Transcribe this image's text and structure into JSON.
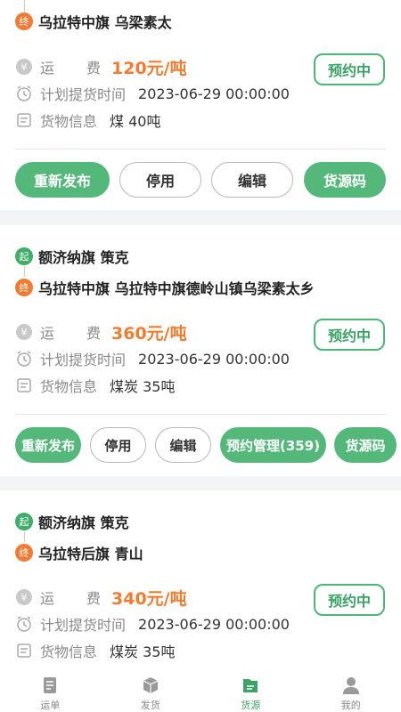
{
  "cards": [
    {
      "end_label": "乌拉特中旗 乌梁素太",
      "fee_label_a": "运",
      "fee_label_b": "费",
      "fee_value": "120元/吨",
      "time_label": "计划提货时间",
      "time_value": "2023-06-29 00:00:00",
      "cargo_label": "货物信息",
      "cargo_value": "煤 40吨",
      "status": "预约中",
      "buttons": [
        "重新发布",
        "停用",
        "编辑",
        "货源码"
      ]
    },
    {
      "start_label": "额济纳旗 策克",
      "end_label": "乌拉特中旗 乌拉特中旗德岭山镇乌梁素太乡",
      "fee_label_a": "运",
      "fee_label_b": "费",
      "fee_value": "360元/吨",
      "time_label": "计划提货时间",
      "time_value": "2023-06-29 00:00:00",
      "cargo_label": "货物信息",
      "cargo_value": "煤炭 35吨",
      "status": "预约中",
      "buttons": [
        "重新发布",
        "停用",
        "编辑",
        "预约管理(359)",
        "货源码"
      ]
    },
    {
      "start_label": "额济纳旗 策克",
      "end_label": "乌拉特后旗 青山",
      "fee_label_a": "运",
      "fee_label_b": "费",
      "fee_value": "340元/吨",
      "time_label": "计划提货时间",
      "time_value": "2023-06-29 00:00:00",
      "cargo_label": "货物信息",
      "cargo_value": "煤炭 35吨",
      "status": "预约中"
    }
  ],
  "route_markers": {
    "start": "起",
    "end": "终"
  },
  "tabbar": {
    "items": [
      {
        "label": "运单",
        "icon": "waybill-icon"
      },
      {
        "label": "发货",
        "icon": "ship-icon"
      },
      {
        "label": "货源",
        "icon": "cargo-source-icon",
        "active": true
      },
      {
        "label": "我的",
        "icon": "profile-icon"
      }
    ]
  },
  "colors": {
    "green": "#55b87b",
    "orange": "#f07c2f",
    "active_tab": "#3aa366"
  }
}
